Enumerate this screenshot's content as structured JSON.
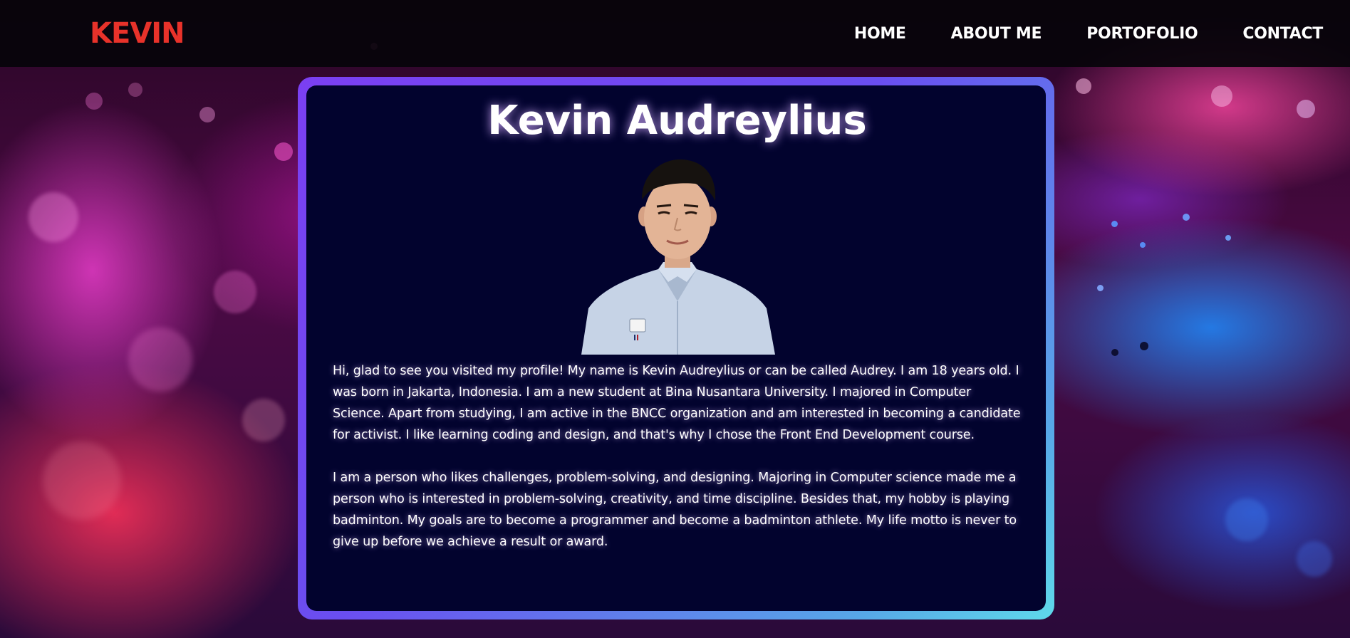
{
  "nav": {
    "logo": "KEVIN",
    "links": [
      "HOME",
      "ABOUT ME",
      "PORTOFOLIO",
      "CONTACT"
    ]
  },
  "profile": {
    "name": "Kevin Audreylius",
    "paragraphs": [
      "Hi, glad to see you visited my profile! My name is Kevin Audreylius or can be called Audrey. I am 18 years old. I was born in Jakarta, Indonesia. I am a new student at Bina Nusantara University. I majored in Computer Science. Apart from studying, I am active in the BNCC organization and am interested in becoming a candidate for activist. I like learning coding and design, and that's why I chose the Front End Development course.",
      "I am a person who likes challenges, problem-solving, and designing. Majoring in Computer science made me a person who is interested in problem-solving, creativity, and time discipline. Besides that, my hobby is playing badminton. My goals are to become a programmer and become a badminton athlete. My life motto is never to give up before we achieve a result or award."
    ]
  },
  "colors": {
    "logo": "#e8322a",
    "card_background": "#02032e",
    "card_border_start": "#7b3ff2",
    "card_border_end": "#5fd9ea"
  },
  "icons": {
    "portrait": "profile-photo"
  }
}
